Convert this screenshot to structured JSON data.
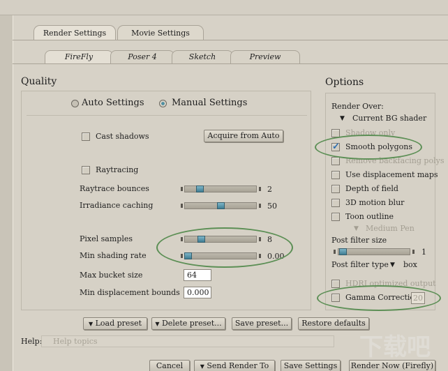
{
  "tabs": [
    "Render Settings",
    "Movie Settings"
  ],
  "subtabs": [
    "FireFly",
    "Poser 4",
    "Sketch",
    "Preview"
  ],
  "quality": {
    "title": "Quality",
    "auto_label": "Auto Settings",
    "manual_label": "Manual Settings",
    "cast_shadows": "Cast shadows",
    "acquire": "Acquire from Auto",
    "raytracing": "Raytracing",
    "raytrace_bounces": {
      "label": "Raytrace bounces",
      "value": "2",
      "fraction": 0.18
    },
    "irradiance_caching": {
      "label": "Irradiance caching",
      "value": "50",
      "fraction": 0.5
    },
    "pixel_samples": {
      "label": "Pixel samples",
      "value": "8",
      "fraction": 0.2
    },
    "min_shading_rate": {
      "label": "Min shading rate",
      "value": "0.00",
      "fraction": 0.0
    },
    "max_bucket": {
      "label": "Max bucket size",
      "value": "64"
    },
    "min_displacement": {
      "label": "Min displacement bounds",
      "value": "0.000"
    }
  },
  "options": {
    "title": "Options",
    "render_over": "Render Over:",
    "bg_shader": "Current BG shader",
    "items": [
      {
        "label": "Shadow only",
        "checked": false,
        "dim": true
      },
      {
        "label": "Smooth polygons",
        "checked": true,
        "dim": false
      },
      {
        "label": "Remove backfacing polys",
        "checked": false,
        "dim": true
      },
      {
        "label": "Use displacement maps",
        "checked": false,
        "dim": false
      },
      {
        "label": "Depth of field",
        "checked": false,
        "dim": false
      },
      {
        "label": "3D motion blur",
        "checked": false,
        "dim": false
      },
      {
        "label": "Toon outline",
        "checked": false,
        "dim": false
      }
    ],
    "medium_pen": "Medium Pen",
    "post_filter_size": {
      "label": "Post filter size",
      "value": "1",
      "fraction": 0.02
    },
    "post_filter_type": {
      "label": "Post filter type",
      "value": "box"
    },
    "hdri": "HDRI optimized output",
    "gamma": {
      "label": "Gamma Correction",
      "value": "20"
    }
  },
  "presets": [
    "Load preset",
    "Delete preset...",
    "Save preset...",
    "Restore defaults"
  ],
  "help": {
    "label": "Help:",
    "placeholder": "Help topics"
  },
  "bottom": [
    "Cancel",
    "Send Render To",
    "Save Settings",
    "Render Now (Firefly)"
  ],
  "watermark": "下载吧"
}
